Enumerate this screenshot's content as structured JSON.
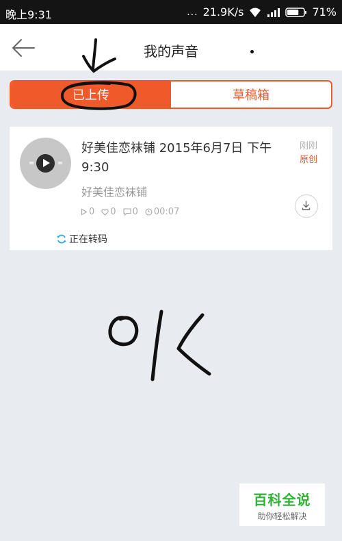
{
  "status_bar": {
    "time": "晚上9:31",
    "dots": "...",
    "network_speed": "21.9K/s",
    "battery": "71%",
    "battery_level": 0.71,
    "icons": [
      "wifi-icon",
      "signal-icon",
      "battery-icon"
    ]
  },
  "header": {
    "title": "我的声音",
    "back_icon": "back-arrow-icon"
  },
  "tabs": [
    {
      "label": "已上传",
      "active": true
    },
    {
      "label": "草稿箱",
      "active": false
    }
  ],
  "track": {
    "title": "好美佳恋袜铺 2015年6月7日 下午9:30",
    "author": "好美佳恋袜铺",
    "time_tag": "刚刚",
    "original_tag": "原创",
    "plays": "0",
    "likes": "0",
    "comments": "0",
    "duration": "00:07",
    "status": "正在转码"
  },
  "watermark": {
    "title": "百科全说",
    "subtitle": "助你轻松解决"
  },
  "colors": {
    "accent": "#f0592a",
    "background": "#e8ebf0",
    "status_bar": "#141414",
    "watermark_green": "#2fb236"
  }
}
